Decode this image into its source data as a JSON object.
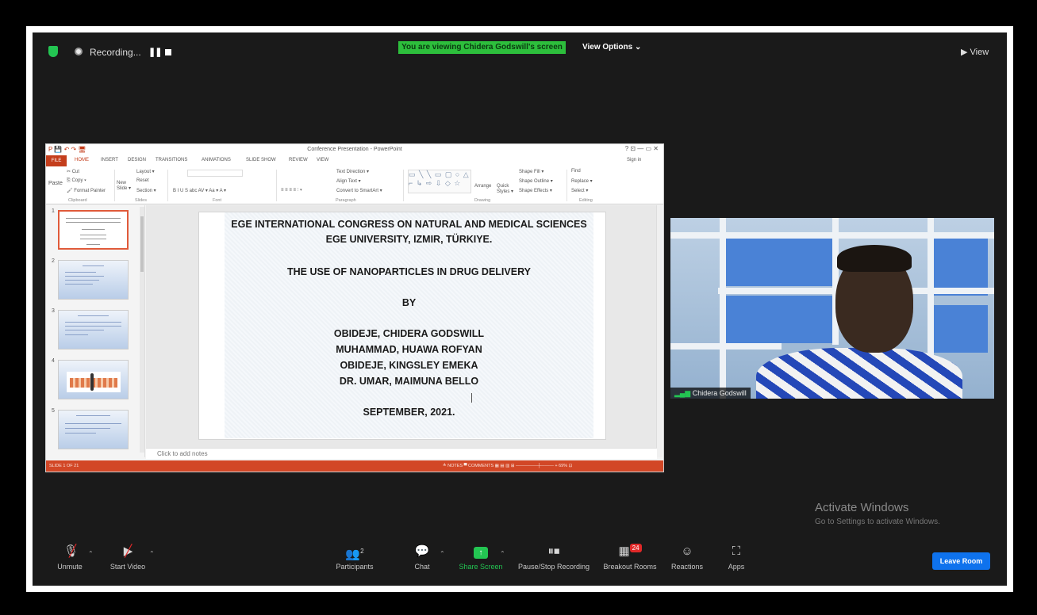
{
  "topbar": {
    "recording_label": "Recording...",
    "pause_glyph": "❚❚",
    "banner": "You are viewing Chidera Godswill's screen",
    "view_options": "View Options ⌄",
    "view": "▶ View"
  },
  "ppt": {
    "window_title": "Conference Presentation - PowerPoint",
    "qat": "P 💾 ↶ ↷ 🖥",
    "window_controls": "?  ⊡  —  ▭  ✕",
    "sign_in": "Sign in",
    "tabs": [
      "FILE",
      "HOME",
      "INSERT",
      "DESIGN",
      "TRANSITIONS",
      "ANIMATIONS",
      "SLIDE SHOW",
      "REVIEW",
      "VIEW"
    ],
    "ribbon": {
      "cut": "✂ Cut",
      "copy": "⎘ Copy ▾",
      "paste": "Paste",
      "format_painter": "🖌 Format Painter",
      "new_slide": "New Slide ▾",
      "layout": "Layout ▾",
      "reset": "Reset",
      "section": "Section ▾",
      "text_direction": "Text Direction ▾",
      "align_text": "Align Text ▾",
      "convert_smartart": "Convert to SmartArt ▾",
      "arrange": "Arrange",
      "quick_styles": "Quick Styles ▾",
      "shape_fill": "Shape Fill ▾",
      "shape_outline": "Shape Outline ▾",
      "shape_effects": "Shape Effects ▾",
      "find": "Find",
      "replace": "Replace ▾",
      "select": "Select ▾",
      "font_row": "B  I  U  S  abc  AV ▾  Aa ▾  A ▾",
      "para_row": "≡ ≡ ≡ ≡  ⫶ ▾",
      "groups": [
        "Clipboard",
        "Slides",
        "Font",
        "Paragraph",
        "Drawing",
        "Editing"
      ]
    },
    "thumb_numbers": [
      "1",
      "2",
      "3",
      "4",
      "5"
    ],
    "slide_lines": [
      "EGE  INTERNATIONAL CONGRESS ON NATURAL AND MEDICAL SCIENCES",
      "EGE UNIVERSITY, IZMIR, TÜRKIYE.",
      "THE USE OF NANOPARTICLES IN DRUG DELIVERY",
      "BY",
      "OBIDEJE, CHIDERA GODSWILL",
      "MUHAMMAD, HUAWA ROFYAN",
      "OBIDEJE, KINGSLEY EMEKA",
      "DR. UMAR, MAIMUNA BELLO",
      "SEPTEMBER, 2021."
    ],
    "notes_placeholder": "Click to add notes",
    "status_left": "SLIDE 1 OF 21",
    "status_right": "≜ NOTES   ▀ COMMENTS     ▦   ▤   ▥   ⊞   —————┼———  +  69%   ⊡"
  },
  "video": {
    "participant_name": "Chidera Godswill",
    "signal_glyph": "▂▄▆"
  },
  "watermark": {
    "title": "Activate Windows",
    "subtitle": "Go to Settings to activate Windows."
  },
  "toolbar": {
    "unmute": "Unmute",
    "start_video": "Start Video",
    "participants": "Participants",
    "participants_count": "2",
    "chat": "Chat",
    "share_screen": "Share Screen",
    "pause_stop": "Pause/Stop Recording",
    "breakout": "Breakout Rooms",
    "breakout_badge": "24",
    "reactions": "Reactions",
    "apps": "Apps",
    "leave": "Leave Room"
  },
  "colors": {
    "share_green": "#23c552",
    "leave_blue": "#0e72ed",
    "ppt_accent": "#d24726"
  }
}
